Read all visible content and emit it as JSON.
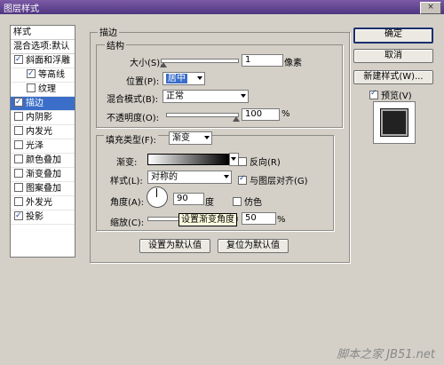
{
  "window": {
    "title": "图层样式",
    "close_glyph": "×"
  },
  "style_list": {
    "header": "样式",
    "blend_options": "混合选项:默认",
    "items": [
      {
        "label": "斜面和浮雕",
        "checked": true,
        "sub": false,
        "selected": false
      },
      {
        "label": "等高线",
        "checked": true,
        "sub": true,
        "selected": false
      },
      {
        "label": "纹理",
        "checked": false,
        "sub": true,
        "selected": false
      },
      {
        "label": "描边",
        "checked": true,
        "sub": false,
        "selected": true
      },
      {
        "label": "内阴影",
        "checked": false,
        "sub": false,
        "selected": false
      },
      {
        "label": "内发光",
        "checked": false,
        "sub": false,
        "selected": false
      },
      {
        "label": "光泽",
        "checked": false,
        "sub": false,
        "selected": false
      },
      {
        "label": "颜色叠加",
        "checked": false,
        "sub": false,
        "selected": false
      },
      {
        "label": "渐变叠加",
        "checked": false,
        "sub": false,
        "selected": false
      },
      {
        "label": "图案叠加",
        "checked": false,
        "sub": false,
        "selected": false
      },
      {
        "label": "外发光",
        "checked": false,
        "sub": false,
        "selected": false
      },
      {
        "label": "投影",
        "checked": true,
        "sub": false,
        "selected": false
      }
    ]
  },
  "stroke": {
    "group_title": "描边",
    "structure_title": "结构",
    "size_label": "大小(S):",
    "size_value": "1",
    "size_unit": "像素",
    "position_label": "位置(P):",
    "position_value": "居中",
    "blend_label": "混合模式(B):",
    "blend_value": "正常",
    "opacity_label": "不透明度(O):",
    "opacity_value": "100",
    "opacity_unit": "%",
    "fill_type_label": "填充类型(F):",
    "fill_type_value": "渐变",
    "gradient_label": "渐变:",
    "reverse_label": "反向(R)",
    "style_label": "样式(L):",
    "style_value": "对称的",
    "align_label": "与图层对齐(G)",
    "angle_label": "角度(A):",
    "angle_value": "90",
    "angle_unit": "度",
    "dither_label": "仿色",
    "scale_label": "缩放(C):",
    "scale_value": "50",
    "scale_unit": "%",
    "tooltip": "设置渐变角度",
    "make_default": "设置为默认值",
    "reset_default": "复位为默认值"
  },
  "buttons": {
    "ok": "确定",
    "cancel": "取消",
    "new_style": "新建样式(W)...",
    "preview": "预览(V)"
  },
  "watermark": "脚本之家 JB51.net",
  "colors": {
    "selection": "#3a6ec9",
    "title_bar": "#5a3f8c",
    "dialog_bg": "#d4d0c8"
  }
}
